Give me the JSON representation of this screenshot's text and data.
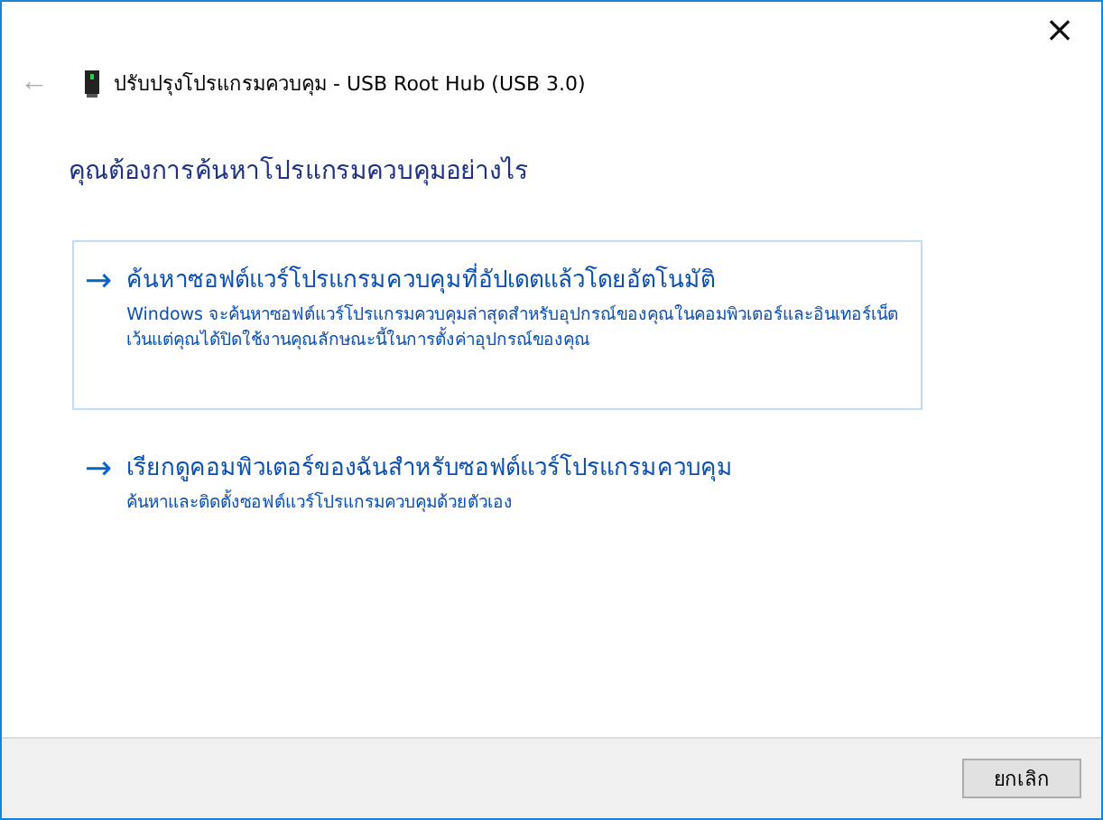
{
  "window": {
    "close": "×"
  },
  "header": {
    "back": "←",
    "back_disabled": true,
    "title": "ปรับปรุงโปรแกรมควบคุม - USB Root Hub (USB 3.0)"
  },
  "heading": "คุณต้องการค้นหาโปรแกรมควบคุมอย่างไร",
  "options": [
    {
      "arrow": "→",
      "title": "ค้นหาซอฟต์แวร์โปรแกรมควบคุมที่อัปเดตแล้วโดยอัตโนมัติ",
      "description": "Windows จะค้นหาซอฟต์แวร์โปรแกรมควบคุมล่าสุดสำหรับอุปกรณ์ของคุณในคอมพิวเตอร์และอินเทอร์เน็ต เว้นแต่คุณได้ปิดใช้งานคุณลักษณะนี้ในการตั้งค่าอุปกรณ์ของคุณ",
      "selected": true
    },
    {
      "arrow": "→",
      "title": "เรียกดูคอมพิวเตอร์ของฉันสำหรับซอฟต์แวร์โปรแกรมควบคุม",
      "description": "ค้นหาและติดตั้งซอฟต์แวร์โปรแกรมควบคุมด้วยตัวเอง",
      "selected": false
    }
  ],
  "buttons": [
    {
      "label": "ยกเลิก"
    }
  ]
}
